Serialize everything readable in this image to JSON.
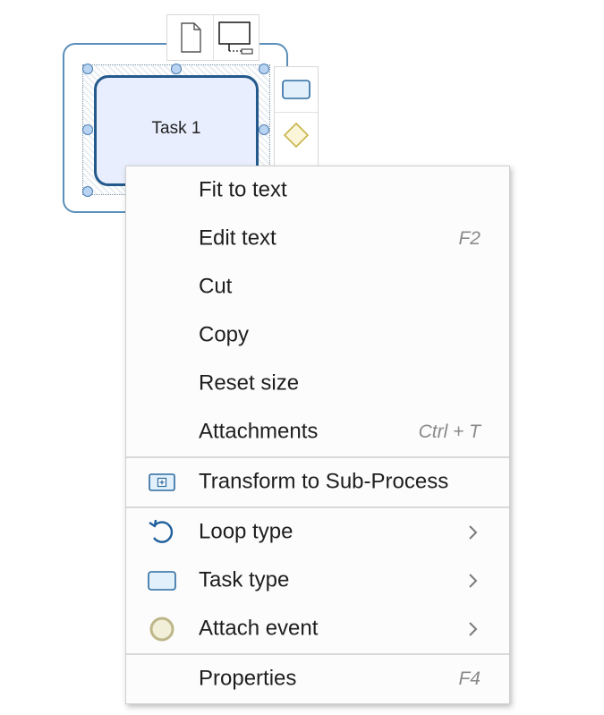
{
  "diagram": {
    "task": {
      "label": "Task 1",
      "fill_color": "#e8eefd",
      "border_color": "#24598c"
    },
    "top_toolbar": {
      "items": [
        {
          "icon": "annotation-page-icon"
        },
        {
          "icon": "task-connector-icon"
        }
      ]
    },
    "side_palette": {
      "items": [
        {
          "icon": "task-rectangle-icon"
        },
        {
          "icon": "gateway-diamond-icon"
        }
      ]
    }
  },
  "context_menu": {
    "groups": [
      {
        "items": [
          {
            "label": "Fit to text",
            "shortcut": ""
          },
          {
            "label": "Edit text",
            "shortcut": "F2"
          },
          {
            "label": "Cut",
            "shortcut": ""
          },
          {
            "label": "Copy",
            "shortcut": ""
          },
          {
            "label": "Reset size",
            "shortcut": ""
          },
          {
            "label": "Attachments",
            "shortcut": "Ctrl + T"
          }
        ]
      },
      {
        "items": [
          {
            "label": "Transform to Sub-Process",
            "icon": "subprocess-icon"
          }
        ]
      },
      {
        "items": [
          {
            "label": "Loop type",
            "icon": "loop-arrow-icon",
            "submenu": true
          },
          {
            "label": "Task type",
            "icon": "task-rectangle-icon",
            "submenu": true
          },
          {
            "label": "Attach event",
            "icon": "event-circle-icon",
            "submenu": true
          }
        ]
      },
      {
        "items": [
          {
            "label": "Properties",
            "shortcut": "F4"
          }
        ]
      }
    ]
  },
  "colors": {
    "accent_blue": "#24598c",
    "handle_fill": "#b9d4f2",
    "gateway_yellow": "#d9c46a",
    "event_circle": "#c9c28f"
  }
}
